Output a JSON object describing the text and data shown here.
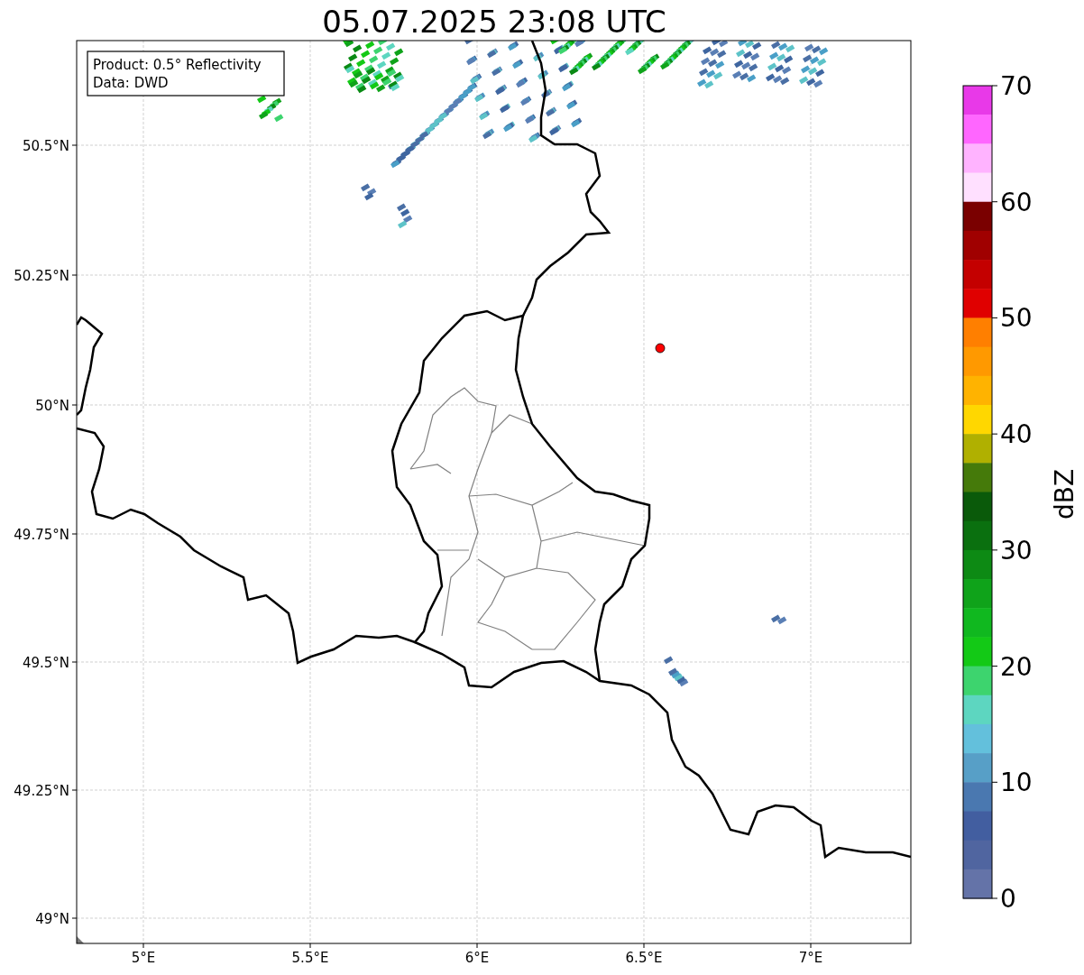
{
  "title": "05.07.2025 23:08 UTC",
  "info_box": [
    "Product: 0.5° Reflectivity",
    "Data: DWD"
  ],
  "map": {
    "lat_labels": [
      "50.5°N",
      "50.25°N",
      "50°N",
      "49.75°N",
      "49.5°N",
      "49.25°N",
      "49°N"
    ],
    "lon_labels": [
      "5°E",
      "5.5°E",
      "6°E",
      "6.5°E",
      "7°E"
    ]
  },
  "colorbar": {
    "label": "dBZ",
    "ticks": [
      "70",
      "60",
      "50",
      "40",
      "30",
      "20",
      "10",
      "0"
    ],
    "segments": [
      {
        "color": "#e839e8"
      },
      {
        "color": "#ff66ff"
      },
      {
        "color": "#ffb3ff"
      },
      {
        "color": "#ffe0ff"
      },
      {
        "color": "#7a0000"
      },
      {
        "color": "#a00000"
      },
      {
        "color": "#c40000"
      },
      {
        "color": "#e00000"
      },
      {
        "color": "#ff7f00"
      },
      {
        "color": "#ff9900"
      },
      {
        "color": "#ffb300"
      },
      {
        "color": "#ffd700"
      },
      {
        "color": "#b0b000"
      },
      {
        "color": "#457a0a"
      },
      {
        "color": "#0a5a0a"
      },
      {
        "color": "#0a700f"
      },
      {
        "color": "#0d8a14"
      },
      {
        "color": "#0fa31a"
      },
      {
        "color": "#10b81f"
      },
      {
        "color": "#13c916"
      },
      {
        "color": "#3dd46e"
      },
      {
        "color": "#5dd6c0"
      },
      {
        "color": "#63c0dc"
      },
      {
        "color": "#579fc7"
      },
      {
        "color": "#4a78b0"
      },
      {
        "color": "#425ea0"
      },
      {
        "color": "#5065a0"
      },
      {
        "color": "#6473a8"
      }
    ]
  }
}
